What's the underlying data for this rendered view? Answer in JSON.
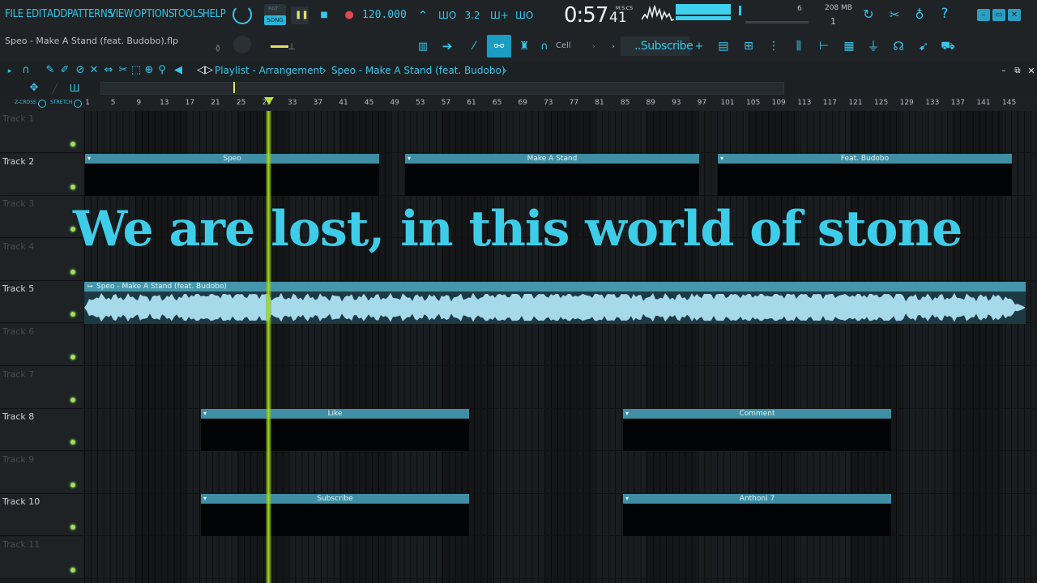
{
  "menu": [
    "FILE",
    "EDIT",
    "ADD",
    "PATTERNS",
    "VIEW",
    "OPTIONS",
    "TOOLS",
    "HELP"
  ],
  "file_title": "Speo - Make A Stand (feat. Budobo).flp",
  "transport": {
    "pat_label": "PAT",
    "song_label": "SONG",
    "tempo": "120.000",
    "time_main": "0:57",
    "time_sub": "41",
    "time_format": "M:S:CS",
    "memory": "208 MB",
    "polyphony": "1"
  },
  "toolbar": {
    "cell_label": "Cell",
    "subscribe_label": "..Subscribe",
    "snap_value": "6"
  },
  "playlist": {
    "title": "Playlist - Arrangement",
    "separator": "›",
    "song": "Speo - Make A Stand (feat. Budobo)",
    "zcross_label": "Z-CROSS",
    "stretch_label": "STRETCH"
  },
  "ruler": [
    "1",
    "5",
    "9",
    "13",
    "17",
    "21",
    "25",
    "29",
    "33",
    "37",
    "41",
    "45",
    "49",
    "53",
    "57",
    "61",
    "65",
    "69",
    "73",
    "77",
    "81",
    "85",
    "89",
    "93",
    "97",
    "101",
    "105",
    "109",
    "113",
    "117",
    "121",
    "125",
    "129",
    "133",
    "137",
    "141",
    "145"
  ],
  "tracks": [
    "Track 1",
    "Track 2",
    "Track 3",
    "Track 4",
    "Track 5",
    "Track 6",
    "Track 7",
    "Track 8",
    "Track 9",
    "Track 10",
    "Track 11"
  ],
  "clips": {
    "t2a": "Speo",
    "t2b": "Make A Stand",
    "t2c": "Feat. Budobo",
    "t5": "Speo - Make A Stand (feat. Budobo)",
    "t8a": "Like",
    "t8b": "Comment",
    "t10a": "Subscribe",
    "t10b": "Anthoni 7"
  },
  "lyric": "We are lost, in this world of stone",
  "icons": [
    "clock-icon",
    "play-icon",
    "stop-icon",
    "record-icon",
    "metronome-icon",
    "cpu-meter-icon",
    "help-icon",
    "minimize-icon",
    "maximize-icon",
    "close-icon"
  ],
  "colors": {
    "accent": "#35c7ea",
    "clip": "#3f8ea4",
    "playhead": "#a6d827",
    "led": "#9be25d"
  }
}
